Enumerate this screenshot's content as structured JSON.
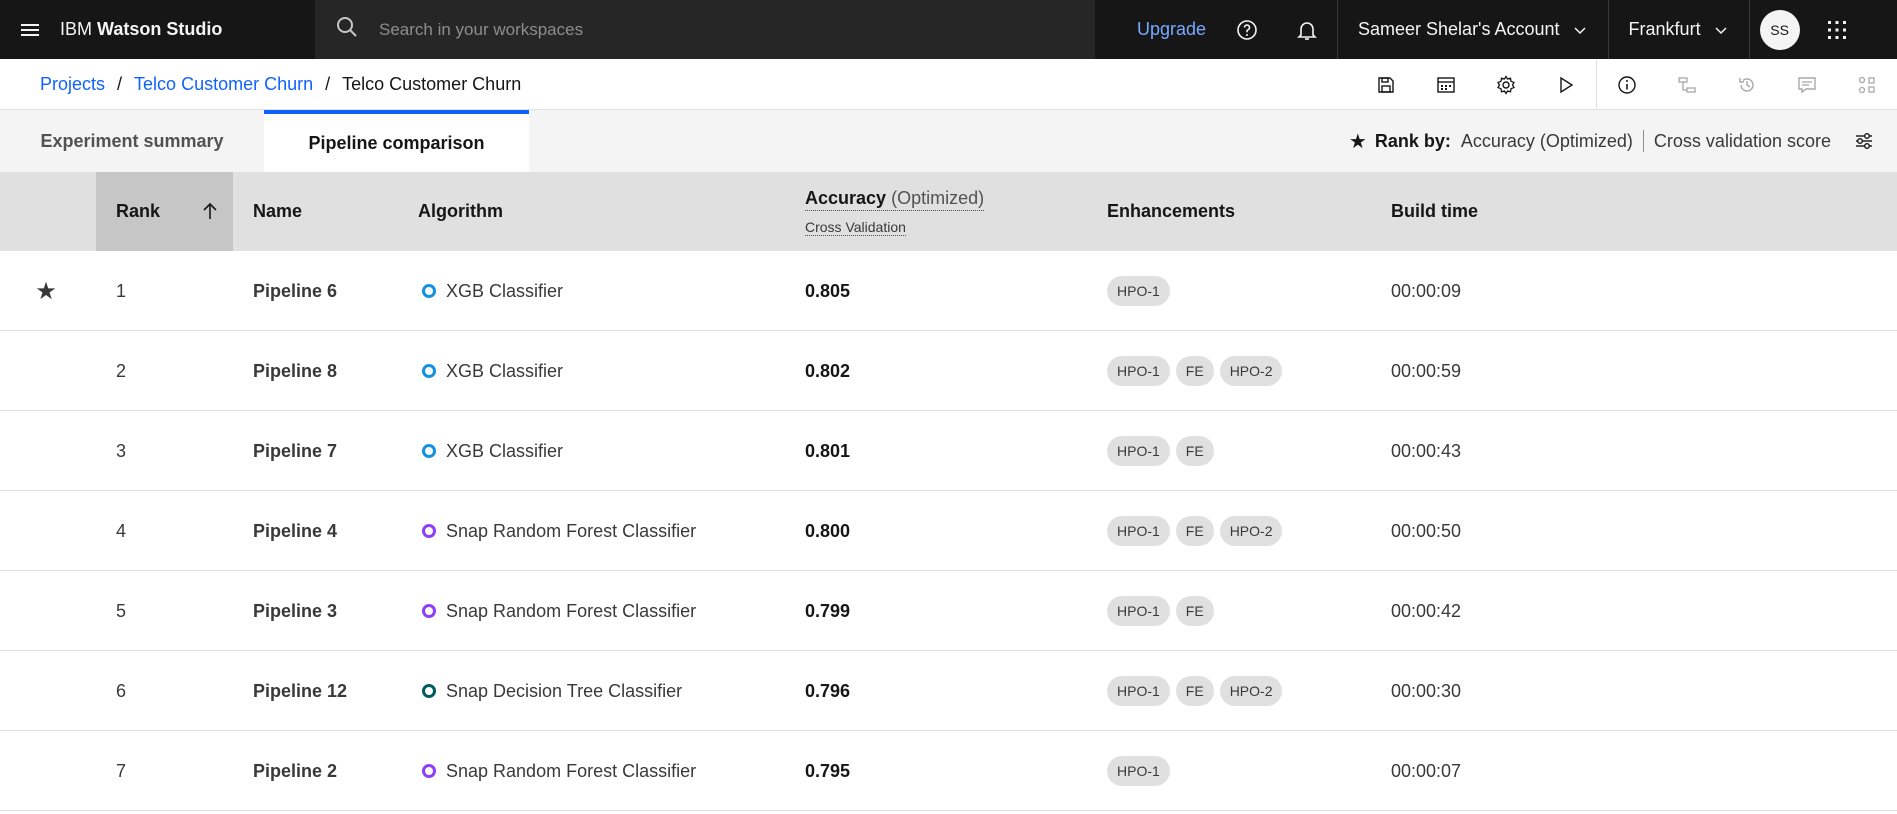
{
  "header": {
    "brand_prefix": "IBM",
    "brand_name": "Watson Studio",
    "search_placeholder": "Search in your workspaces",
    "upgrade_label": "Upgrade",
    "account_label": "Sameer Shelar's Account",
    "region_label": "Frankfurt",
    "avatar_initials": "SS",
    "icons": [
      "menu-icon",
      "search-icon",
      "help-icon",
      "notification-icon",
      "chevron-down-icon",
      "app-switcher-icon"
    ]
  },
  "breadcrumb": {
    "items": [
      "Projects",
      "Telco Customer Churn"
    ],
    "current": "Telco Customer Churn",
    "separator": "/"
  },
  "toolbar": {
    "icons": [
      "save-icon",
      "calendar-icon",
      "settings-icon",
      "run-icon",
      "info-icon",
      "pipeline-icon",
      "history-icon",
      "comment-icon",
      "assets-icon"
    ]
  },
  "tabs": {
    "summary_label": "Experiment summary",
    "comparison_label": "Pipeline comparison",
    "active": "Pipeline comparison"
  },
  "rank_by": {
    "label": "Rank by:",
    "metric": "Accuracy (Optimized)",
    "score": "Cross validation score"
  },
  "table": {
    "columns": {
      "rank": "Rank",
      "name": "Name",
      "algorithm": "Algorithm",
      "accuracy": "Accuracy",
      "accuracy_note": "(Optimized)",
      "accuracy_sub": "Cross Validation",
      "enhancements": "Enhancements",
      "build_time": "Build time"
    },
    "rows": [
      {
        "rank": "1",
        "name": "Pipeline 6",
        "algorithm": "XGB Classifier",
        "algo_color": "#1192e8",
        "accuracy": "0.805",
        "enhancements": [
          "HPO-1"
        ],
        "build_time": "00:00:09",
        "starred": true
      },
      {
        "rank": "2",
        "name": "Pipeline 8",
        "algorithm": "XGB Classifier",
        "algo_color": "#1192e8",
        "accuracy": "0.802",
        "enhancements": [
          "HPO-1",
          "FE",
          "HPO-2"
        ],
        "build_time": "00:00:59",
        "starred": false
      },
      {
        "rank": "3",
        "name": "Pipeline 7",
        "algorithm": "XGB Classifier",
        "algo_color": "#1192e8",
        "accuracy": "0.801",
        "enhancements": [
          "HPO-1",
          "FE"
        ],
        "build_time": "00:00:43",
        "starred": false
      },
      {
        "rank": "4",
        "name": "Pipeline 4",
        "algorithm": "Snap Random Forest Classifier",
        "algo_color": "#8a3ffc",
        "accuracy": "0.800",
        "enhancements": [
          "HPO-1",
          "FE",
          "HPO-2"
        ],
        "build_time": "00:00:50",
        "starred": false
      },
      {
        "rank": "5",
        "name": "Pipeline 3",
        "algorithm": "Snap Random Forest Classifier",
        "algo_color": "#8a3ffc",
        "accuracy": "0.799",
        "enhancements": [
          "HPO-1",
          "FE"
        ],
        "build_time": "00:00:42",
        "starred": false
      },
      {
        "rank": "6",
        "name": "Pipeline 12",
        "algorithm": "Snap Decision Tree Classifier",
        "algo_color": "#005d5d",
        "accuracy": "0.796",
        "enhancements": [
          "HPO-1",
          "FE",
          "HPO-2"
        ],
        "build_time": "00:00:30",
        "starred": false
      },
      {
        "rank": "7",
        "name": "Pipeline 2",
        "algorithm": "Snap Random Forest Classifier",
        "algo_color": "#8a3ffc",
        "accuracy": "0.795",
        "enhancements": [
          "HPO-1"
        ],
        "build_time": "00:00:07",
        "starred": false
      }
    ]
  }
}
